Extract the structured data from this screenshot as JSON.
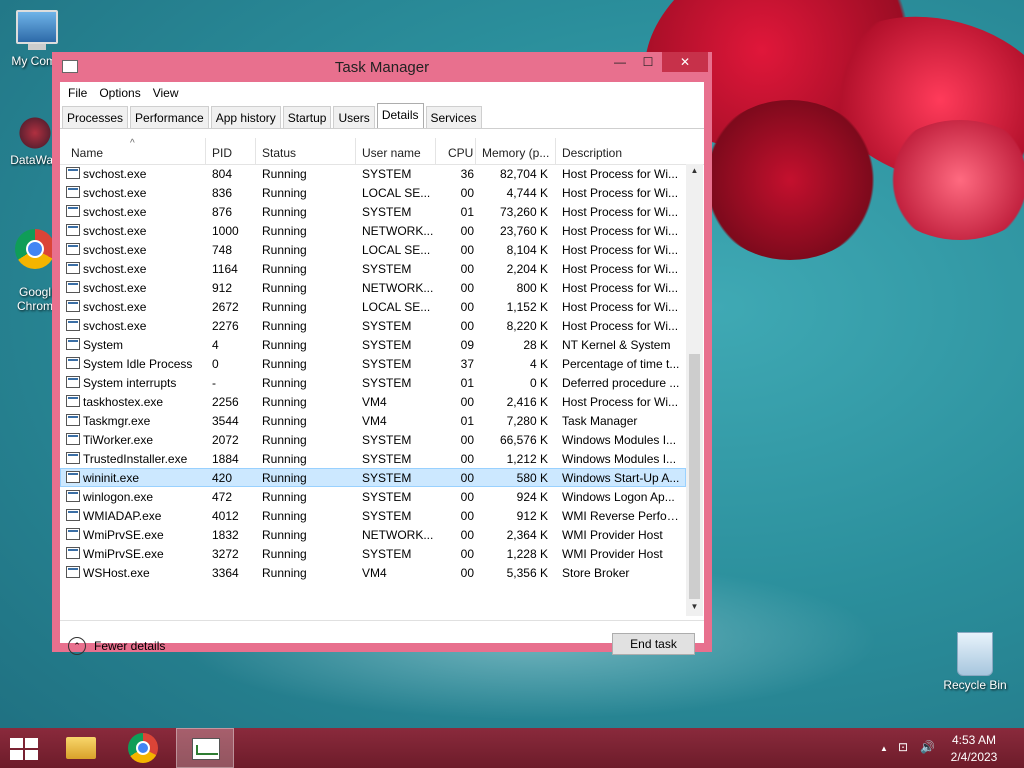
{
  "desktop": {
    "icons": [
      {
        "label": "My Comp",
        "icon": "computer-icon"
      },
      {
        "label": "DataWag",
        "icon": "datawag-icon"
      },
      {
        "label": "Googl\nChrom",
        "icon": "chrome-icon"
      },
      {
        "label": "Recycle Bin",
        "icon": "recycle-bin-icon"
      }
    ]
  },
  "window": {
    "title": "Task Manager",
    "buttons": {
      "minimize": "—",
      "maximize": "☐",
      "close": "✕"
    },
    "menu": [
      "File",
      "Options",
      "View"
    ],
    "tabs": [
      "Processes",
      "Performance",
      "App history",
      "Startup",
      "Users",
      "Details",
      "Services"
    ],
    "active_tab": "Details",
    "columns": {
      "name": "Name",
      "pid": "PID",
      "status": "Status",
      "user": "User name",
      "cpu": "CPU",
      "memory": "Memory (p...",
      "description": "Description"
    },
    "sort_indicator": "^",
    "rows": [
      {
        "name": "svchost.exe",
        "pid": "804",
        "status": "Running",
        "user": "SYSTEM",
        "cpu": "36",
        "mem": "82,704 K",
        "desc": "Host Process for Wi..."
      },
      {
        "name": "svchost.exe",
        "pid": "836",
        "status": "Running",
        "user": "LOCAL SE...",
        "cpu": "00",
        "mem": "4,744 K",
        "desc": "Host Process for Wi..."
      },
      {
        "name": "svchost.exe",
        "pid": "876",
        "status": "Running",
        "user": "SYSTEM",
        "cpu": "01",
        "mem": "73,260 K",
        "desc": "Host Process for Wi..."
      },
      {
        "name": "svchost.exe",
        "pid": "1000",
        "status": "Running",
        "user": "NETWORK...",
        "cpu": "00",
        "mem": "23,760 K",
        "desc": "Host Process for Wi..."
      },
      {
        "name": "svchost.exe",
        "pid": "748",
        "status": "Running",
        "user": "LOCAL SE...",
        "cpu": "00",
        "mem": "8,104 K",
        "desc": "Host Process for Wi..."
      },
      {
        "name": "svchost.exe",
        "pid": "1164",
        "status": "Running",
        "user": "SYSTEM",
        "cpu": "00",
        "mem": "2,204 K",
        "desc": "Host Process for Wi..."
      },
      {
        "name": "svchost.exe",
        "pid": "912",
        "status": "Running",
        "user": "NETWORK...",
        "cpu": "00",
        "mem": "800 K",
        "desc": "Host Process for Wi..."
      },
      {
        "name": "svchost.exe",
        "pid": "2672",
        "status": "Running",
        "user": "LOCAL SE...",
        "cpu": "00",
        "mem": "1,152 K",
        "desc": "Host Process for Wi..."
      },
      {
        "name": "svchost.exe",
        "pid": "2276",
        "status": "Running",
        "user": "SYSTEM",
        "cpu": "00",
        "mem": "8,220 K",
        "desc": "Host Process for Wi..."
      },
      {
        "name": "System",
        "pid": "4",
        "status": "Running",
        "user": "SYSTEM",
        "cpu": "09",
        "mem": "28 K",
        "desc": "NT Kernel & System"
      },
      {
        "name": "System Idle Process",
        "pid": "0",
        "status": "Running",
        "user": "SYSTEM",
        "cpu": "37",
        "mem": "4 K",
        "desc": "Percentage of time t..."
      },
      {
        "name": "System interrupts",
        "pid": "-",
        "status": "Running",
        "user": "SYSTEM",
        "cpu": "01",
        "mem": "0 K",
        "desc": "Deferred procedure ..."
      },
      {
        "name": "taskhostex.exe",
        "pid": "2256",
        "status": "Running",
        "user": "VM4",
        "cpu": "00",
        "mem": "2,416 K",
        "desc": "Host Process for Wi..."
      },
      {
        "name": "Taskmgr.exe",
        "pid": "3544",
        "status": "Running",
        "user": "VM4",
        "cpu": "01",
        "mem": "7,280 K",
        "desc": "Task Manager"
      },
      {
        "name": "TiWorker.exe",
        "pid": "2072",
        "status": "Running",
        "user": "SYSTEM",
        "cpu": "00",
        "mem": "66,576 K",
        "desc": "Windows Modules I..."
      },
      {
        "name": "TrustedInstaller.exe",
        "pid": "1884",
        "status": "Running",
        "user": "SYSTEM",
        "cpu": "00",
        "mem": "1,212 K",
        "desc": "Windows Modules I..."
      },
      {
        "name": "wininit.exe",
        "pid": "420",
        "status": "Running",
        "user": "SYSTEM",
        "cpu": "00",
        "mem": "580 K",
        "desc": "Windows Start-Up A...",
        "selected": true
      },
      {
        "name": "winlogon.exe",
        "pid": "472",
        "status": "Running",
        "user": "SYSTEM",
        "cpu": "00",
        "mem": "924 K",
        "desc": "Windows Logon Ap..."
      },
      {
        "name": "WMIADAP.exe",
        "pid": "4012",
        "status": "Running",
        "user": "SYSTEM",
        "cpu": "00",
        "mem": "912 K",
        "desc": "WMI Reverse Perfor..."
      },
      {
        "name": "WmiPrvSE.exe",
        "pid": "1832",
        "status": "Running",
        "user": "NETWORK...",
        "cpu": "00",
        "mem": "2,364 K",
        "desc": "WMI Provider Host"
      },
      {
        "name": "WmiPrvSE.exe",
        "pid": "3272",
        "status": "Running",
        "user": "SYSTEM",
        "cpu": "00",
        "mem": "1,228 K",
        "desc": "WMI Provider Host"
      },
      {
        "name": "WSHost.exe",
        "pid": "3364",
        "status": "Running",
        "user": "VM4",
        "cpu": "00",
        "mem": "5,356 K",
        "desc": "Store Broker"
      }
    ],
    "fewer_details": "Fewer details",
    "fewer_icon": "⌃",
    "end_task": "End task"
  },
  "taskbar": {
    "clock_time": "4:53 AM",
    "clock_date": "2/4/2023",
    "tray_icons": [
      "▲",
      "⊡",
      "🔊"
    ],
    "accent": "#7a2030"
  }
}
